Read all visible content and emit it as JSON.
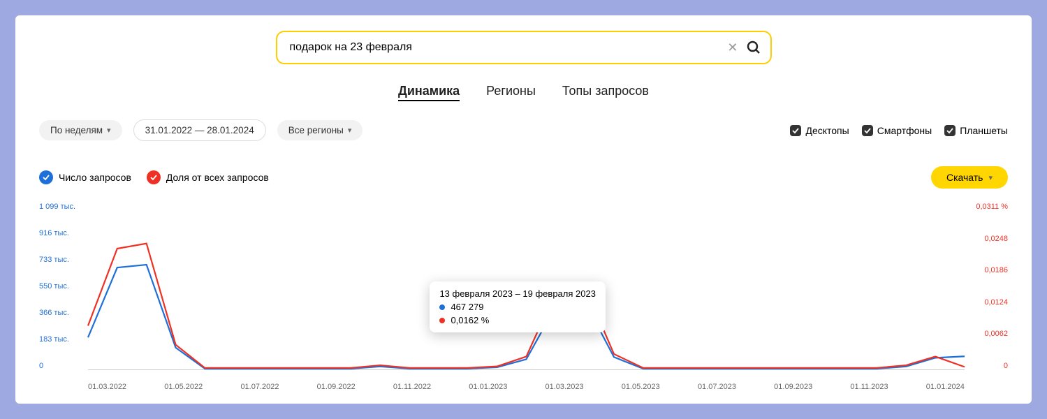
{
  "search": {
    "value": "подарок на 23 февраля"
  },
  "tabs": {
    "dynamics": "Динамика",
    "regions": "Регионы",
    "top_queries": "Топы запросов"
  },
  "filters": {
    "period_mode": "По неделям",
    "date_range": "31.01.2022 — 28.01.2024",
    "region": "Все регионы"
  },
  "devices": {
    "desktop": "Десктопы",
    "smartphone": "Смартфоны",
    "tablet": "Планшеты"
  },
  "legend": {
    "queries_count": "Число запросов",
    "share_all": "Доля от всех запросов"
  },
  "download_label": "Скачать",
  "tooltip": {
    "date_range": "13 февраля 2023 – 19 февраля 2023",
    "value_blue": "467 279",
    "value_red": "0,0162 %"
  },
  "chart_data": {
    "type": "line",
    "title": "",
    "xlabel": "",
    "ylabel_left": "Число запросов",
    "ylabel_right": "Доля от всех запросов",
    "y_left_ticks": [
      "1 099 тыс.",
      "916 тыс.",
      "733 тыс.",
      "550 тыс.",
      "366 тыс.",
      "183 тыс.",
      "0"
    ],
    "y_right_ticks": [
      "0,0311 %",
      "0,0248",
      "0,0186",
      "0,0124",
      "0,0062",
      "0"
    ],
    "x_ticks": [
      "01.03.2022",
      "01.05.2022",
      "01.07.2022",
      "01.09.2022",
      "01.11.2022",
      "01.01.2023",
      "01.03.2023",
      "01.05.2023",
      "01.07.2023",
      "01.09.2023",
      "01.11.2023",
      "01.01.2024"
    ],
    "ylim_left": [
      0,
      1099000
    ],
    "ylim_right": [
      0,
      0.0311
    ],
    "series": [
      {
        "name": "Число запросов",
        "color": "#1f6fd8",
        "axis": "left",
        "x": [
          0,
          1,
          2,
          3,
          4,
          5,
          6,
          7,
          8,
          9,
          10,
          11,
          12,
          13,
          14,
          15,
          16,
          17,
          18,
          19,
          20,
          21,
          22,
          23,
          24,
          25,
          26,
          27,
          28,
          29,
          30
        ],
        "y": [
          220000,
          700000,
          720000,
          150000,
          5000,
          5000,
          5000,
          5000,
          5000,
          5000,
          20000,
          5000,
          5000,
          5000,
          15000,
          70000,
          430000,
          467279,
          85000,
          5000,
          5000,
          5000,
          5000,
          5000,
          5000,
          5000,
          5000,
          5000,
          20000,
          80000,
          90000
        ]
      },
      {
        "name": "Доля от всех запросов",
        "color": "#ee3124",
        "axis": "right",
        "x": [
          0,
          1,
          2,
          3,
          4,
          5,
          6,
          7,
          8,
          9,
          10,
          11,
          12,
          13,
          14,
          15,
          16,
          17,
          18,
          19,
          20,
          21,
          22,
          23,
          24,
          25,
          26,
          27,
          28,
          29,
          30
        ],
        "y": [
          0.0085,
          0.0235,
          0.0245,
          0.0048,
          0.0003,
          0.0003,
          0.0003,
          0.0003,
          0.0003,
          0.0003,
          0.0008,
          0.0003,
          0.0003,
          0.0003,
          0.0006,
          0.0025,
          0.015,
          0.0162,
          0.003,
          0.0003,
          0.0003,
          0.0003,
          0.0003,
          0.0003,
          0.0003,
          0.0003,
          0.0003,
          0.0003,
          0.0008,
          0.0025,
          0.0005
        ]
      }
    ]
  }
}
